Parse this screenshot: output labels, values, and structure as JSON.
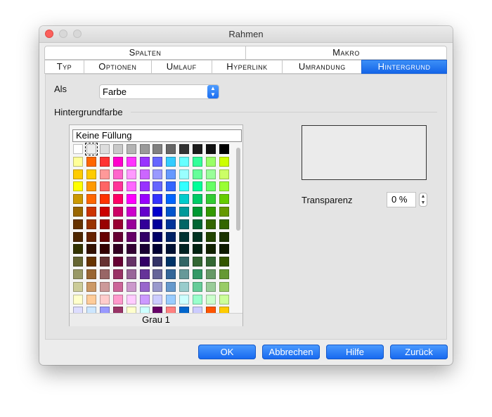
{
  "window": {
    "title": "Rahmen"
  },
  "tabs_row1": [
    {
      "label": "Spalten"
    },
    {
      "label": "Makro"
    }
  ],
  "tabs_row2": [
    {
      "label": "Typ"
    },
    {
      "label": "Optionen"
    },
    {
      "label": "Umlauf"
    },
    {
      "label": "Hyperlink"
    },
    {
      "label": "Umrandung"
    },
    {
      "label": "Hintergrund",
      "active": true
    }
  ],
  "as": {
    "label": "Als",
    "value": "Farbe"
  },
  "background_color": {
    "heading": "Hintergrundfarbe",
    "no_fill": "Keine Füllung",
    "selected_name": "Grau 1",
    "palette": [
      [
        "#ffffff",
        "#eeeeee",
        "#dddddd",
        "#c8c8c8",
        "#b3b3b3",
        "#999999",
        "#808080",
        "#666666",
        "#333333",
        "#1c1c1c",
        "#111111",
        "#000000"
      ],
      [
        "#ffff99",
        "#ff6600",
        "#ff3333",
        "#ff00cc",
        "#ff33ff",
        "#9933ff",
        "#6666ff",
        "#33ccff",
        "#66ffff",
        "#33ff99",
        "#99ff66",
        "#ccff00"
      ],
      [
        "#ffcc00",
        "#ffcc00",
        "#ff9999",
        "#ff66cc",
        "#ff99ff",
        "#cc66ff",
        "#9999ff",
        "#6699ff",
        "#99ffff",
        "#66ff99",
        "#99ff99",
        "#ccff66"
      ],
      [
        "#ffff00",
        "#ff9900",
        "#ff6666",
        "#ff3399",
        "#ff66ff",
        "#9933ff",
        "#6666ff",
        "#3366ff",
        "#33ffff",
        "#00ff99",
        "#66ff66",
        "#99ff33"
      ],
      [
        "#cc9900",
        "#ff6600",
        "#ff3300",
        "#ff0066",
        "#ff00ff",
        "#9900ff",
        "#3333ff",
        "#0066ff",
        "#00cccc",
        "#00cc66",
        "#33cc33",
        "#66cc00"
      ],
      [
        "#996600",
        "#cc3300",
        "#cc0000",
        "#cc0066",
        "#cc00cc",
        "#6600cc",
        "#0000cc",
        "#0055cc",
        "#009999",
        "#009933",
        "#339900",
        "#669900"
      ],
      [
        "#663300",
        "#993300",
        "#990000",
        "#990033",
        "#990099",
        "#330099",
        "#000099",
        "#003399",
        "#006666",
        "#006633",
        "#336600",
        "#336600"
      ],
      [
        "#4d2600",
        "#662200",
        "#660000",
        "#660033",
        "#660066",
        "#330066",
        "#000066",
        "#002266",
        "#003333",
        "#003322",
        "#224400",
        "#1a3300"
      ],
      [
        "#333300",
        "#331100",
        "#330000",
        "#330022",
        "#330033",
        "#1a0033",
        "#000033",
        "#001133",
        "#002222",
        "#002211",
        "#112200",
        "#0d1a00"
      ],
      [
        "#666633",
        "#663300",
        "#663333",
        "#660033",
        "#663366",
        "#330066",
        "#333366",
        "#003366",
        "#336666",
        "#336633",
        "#336633",
        "#335500"
      ],
      [
        "#999966",
        "#996633",
        "#996666",
        "#993366",
        "#996699",
        "#663399",
        "#666699",
        "#336699",
        "#669999",
        "#339966",
        "#669966",
        "#669933"
      ],
      [
        "#cccc99",
        "#cc9966",
        "#cc9999",
        "#cc6699",
        "#cc99cc",
        "#9966cc",
        "#9999cc",
        "#6699cc",
        "#99cccc",
        "#66cc99",
        "#99cc99",
        "#99cc66"
      ],
      [
        "#ffffcc",
        "#ffcc99",
        "#ffcccc",
        "#ff99cc",
        "#ffccff",
        "#cc99ff",
        "#ccccff",
        "#99ccff",
        "#ccffff",
        "#99ffcc",
        "#ccffcc",
        "#ccff99"
      ],
      [
        "#ddddff",
        "#cce6ff",
        "#9999ff",
        "#993366",
        "#ffffcc",
        "#ccffff",
        "#660066",
        "#ff8080",
        "#0066cc",
        "#ccccff",
        "#ff5500",
        "#ffcc00"
      ]
    ]
  },
  "transparency": {
    "label": "Transparenz",
    "value": "0 %"
  },
  "buttons": {
    "ok": "OK",
    "cancel": "Abbrechen",
    "help": "Hilfe",
    "back": "Zurück"
  }
}
